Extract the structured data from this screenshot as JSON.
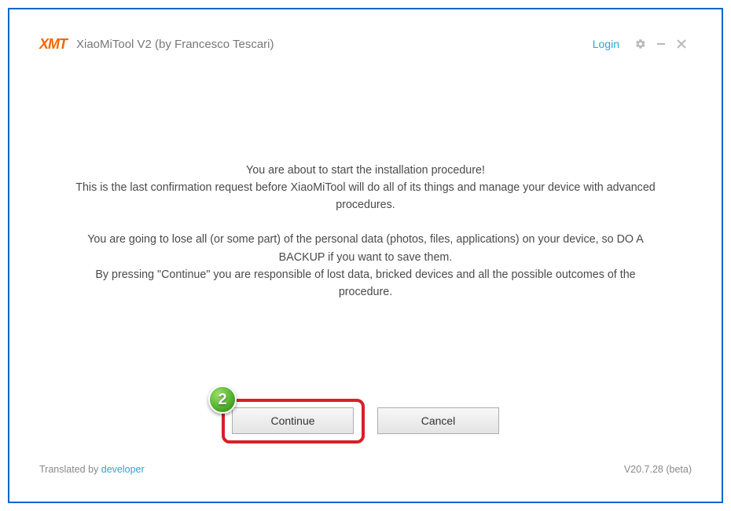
{
  "titlebar": {
    "logo": "XMT",
    "title": "XiaoMiTool V2 (by Francesco Tescari)",
    "login": "Login"
  },
  "message": {
    "line1": "You are about to start the installation procedure!",
    "line2": "This is the last confirmation request before XiaoMiTool will do all of its things and manage your device with advanced procedures.",
    "line3": "You are going to lose all (or some part) of the personal data (photos, files, applications) on your device, so DO A BACKUP if you want to save them.",
    "line4": "By pressing \"Continue\" you are responsible of lost data, bricked devices and all the possible outcomes of the procedure."
  },
  "buttons": {
    "continue": "Continue",
    "cancel": "Cancel"
  },
  "annotation": {
    "step": "2"
  },
  "footer": {
    "translated_prefix": "Translated by ",
    "translated_link": "developer",
    "version": "V20.7.28 (beta)"
  }
}
